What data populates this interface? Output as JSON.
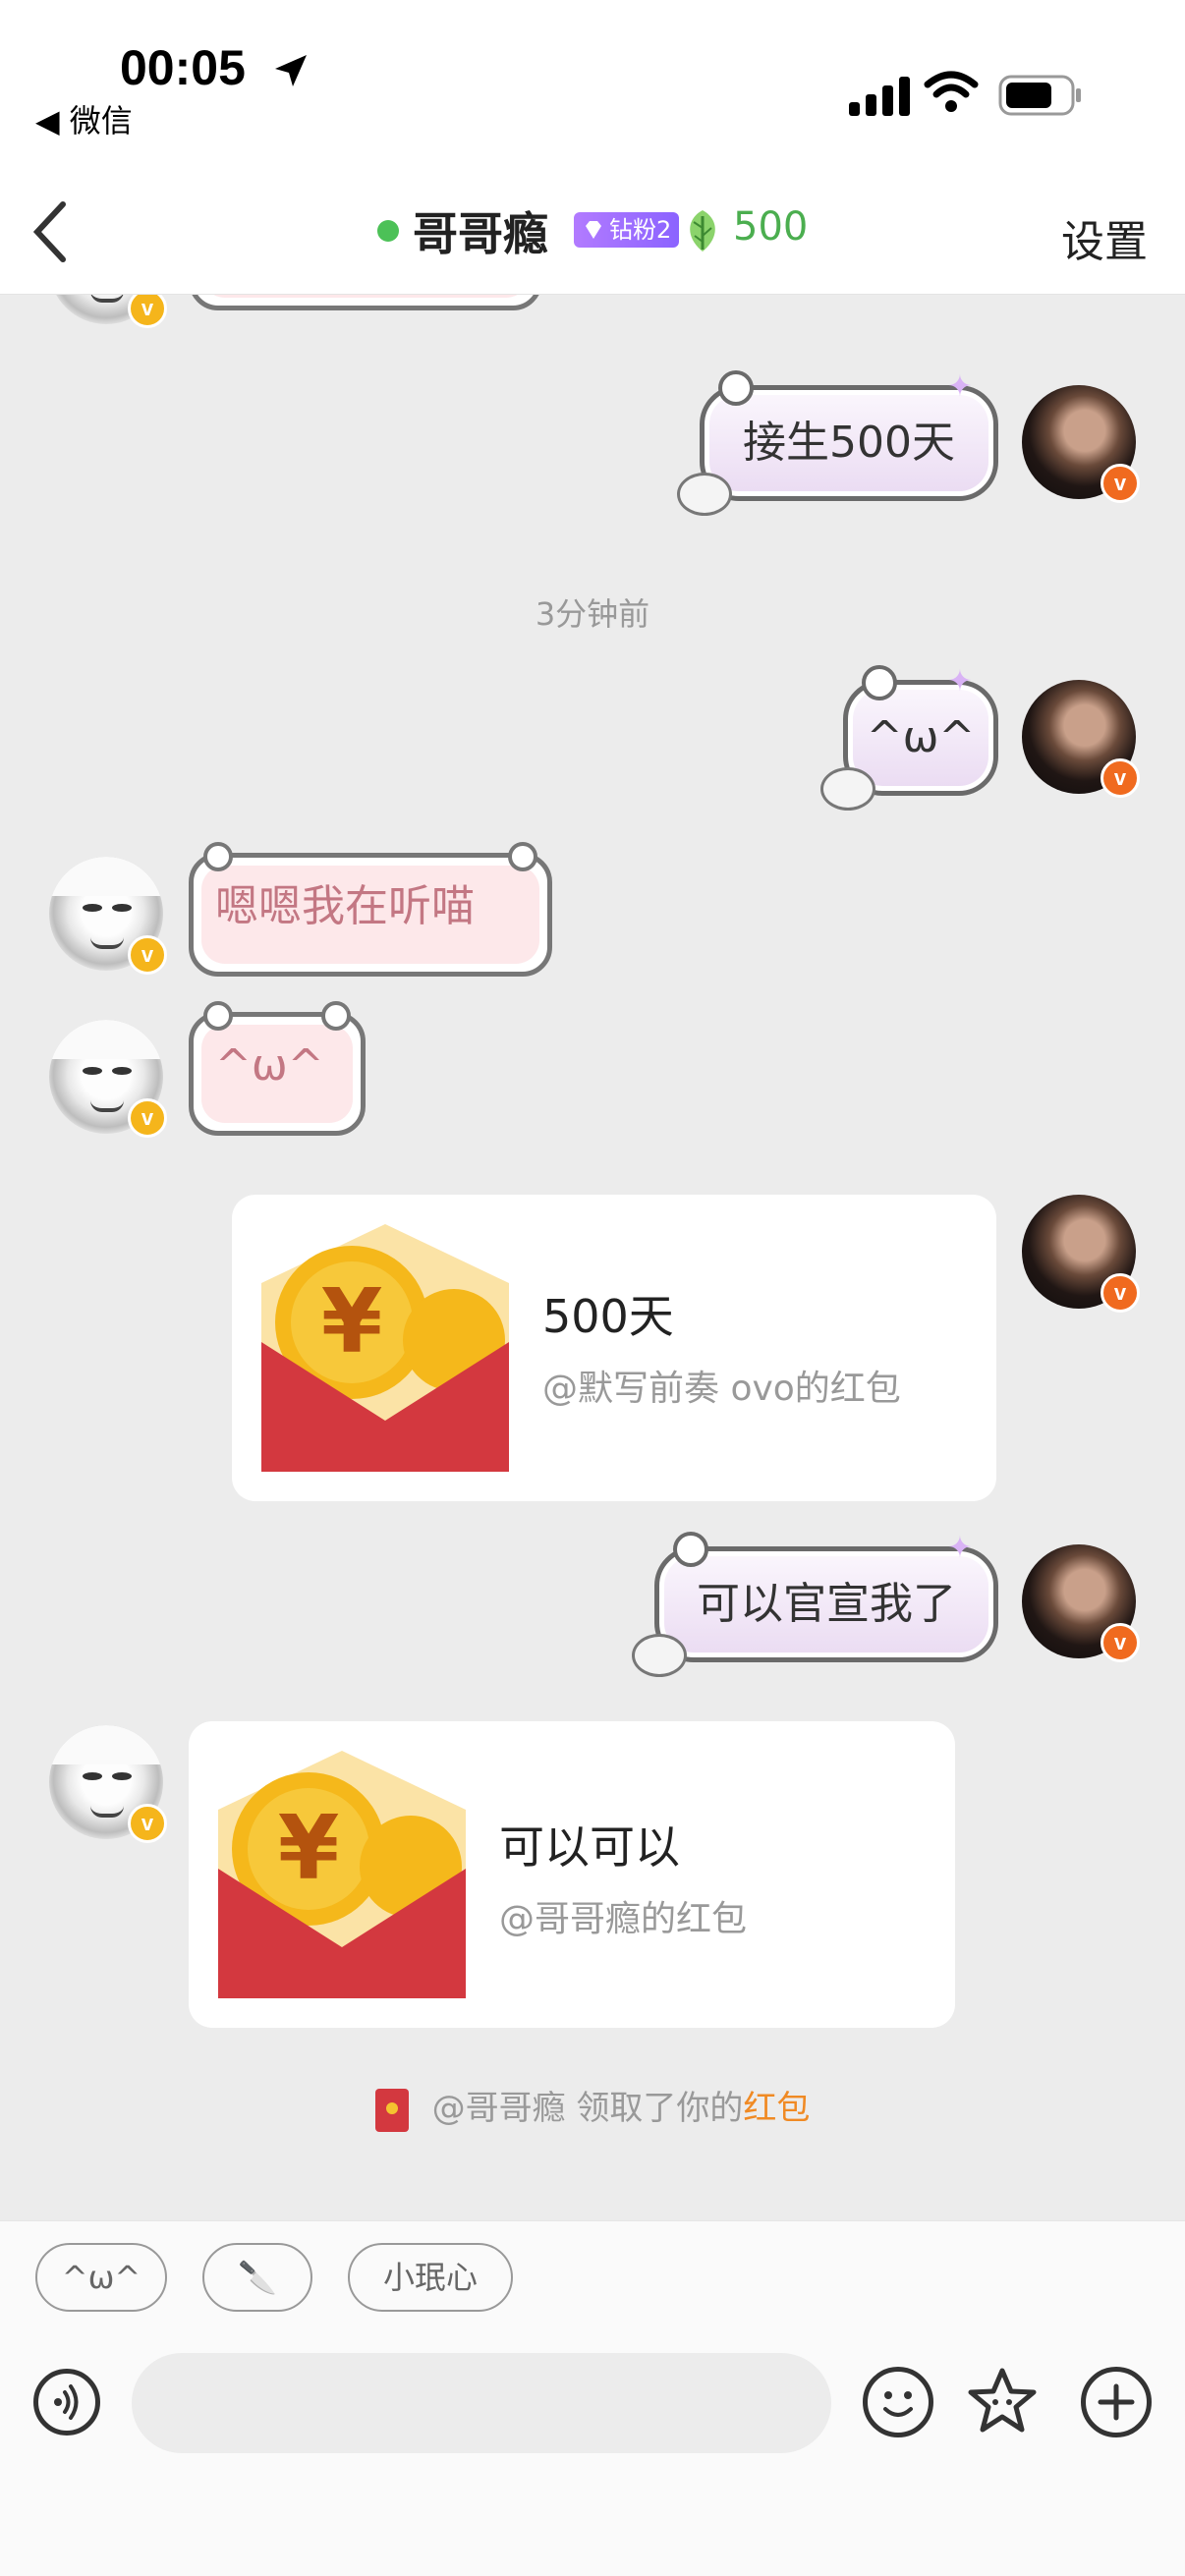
{
  "status_bar": {
    "time": "00:05",
    "back_app": "◀ 微信"
  },
  "nav": {
    "title": "哥哥瘾",
    "fan_badge": "钻粉2",
    "leaf_count": "500",
    "settings": "设置"
  },
  "messages": {
    "m1": "接生500天",
    "timestamp": "3分钟前",
    "m2": "^ω^",
    "m3": "嗯嗯我在听喵",
    "m4": "^ω^",
    "packet1": {
      "title": "500天",
      "sub": "@默写前奏 ovo的红包"
    },
    "m5": "可以官宣我了",
    "packet2": {
      "title": "可以可以",
      "sub": "@哥哥瘾的红包"
    },
    "notice": {
      "prefix": "@哥哥瘾 领取了你的",
      "highlight": "红包"
    }
  },
  "quick_replies": [
    "^ω^",
    "🔪",
    "小珉心"
  ],
  "colors": {
    "accent_green": "#4bae4f",
    "badge_purple": "#8b63ff",
    "red_packet": "#d3383f",
    "highlight_orange": "#f08a24"
  },
  "icons": [
    "location-arrow-icon",
    "signal-icon",
    "wifi-icon",
    "battery-icon",
    "back-chevron-icon",
    "gem-icon",
    "leaf-icon",
    "voice-icon",
    "emoji-icon",
    "favorite-icon",
    "plus-icon"
  ]
}
